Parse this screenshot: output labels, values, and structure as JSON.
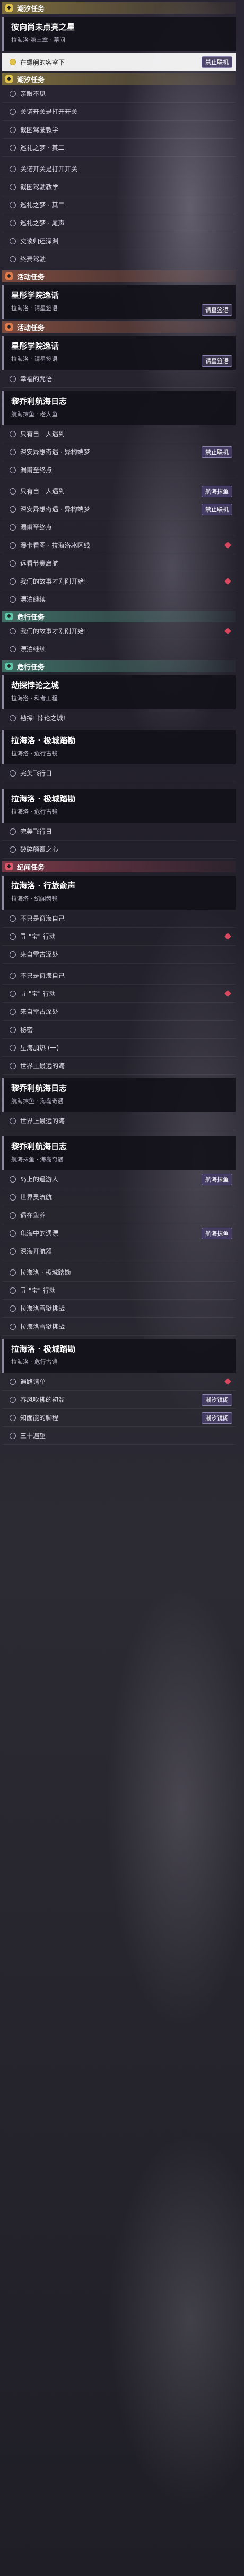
{
  "sections": [
    {
      "type": "header",
      "color": "yellow",
      "label": "潮汐任务"
    },
    {
      "type": "quest",
      "title": "彼向尚未点亮之星",
      "sub": "拉海洛·第三章 · 幕间"
    },
    {
      "type": "step",
      "label": "在螺舸的客室下",
      "current": true,
      "badge": "禁止联机"
    },
    {
      "type": "header",
      "color": "yellow",
      "label": "潮汐任务"
    },
    {
      "type": "step",
      "label": "亲眼不见"
    },
    {
      "type": "step",
      "label": "关诺开关是打开开关"
    },
    {
      "type": "step",
      "label": "截困驾驶教学"
    },
    {
      "type": "step",
      "label": "巡礼之梦 · 其二"
    },
    {
      "type": "spacer"
    },
    {
      "type": "step",
      "label": "关诺开关是打开开关"
    },
    {
      "type": "step",
      "label": "截困驾驶教学"
    },
    {
      "type": "step",
      "label": "巡礼之梦 · 其二"
    },
    {
      "type": "step",
      "label": "巡礼之梦 · 尾声"
    },
    {
      "type": "step",
      "label": "交谈归还深渊"
    },
    {
      "type": "step",
      "label": "终焉驾驶"
    },
    {
      "type": "header",
      "color": "orange",
      "label": "活动任务"
    },
    {
      "type": "quest",
      "title": "星彤学院逸话",
      "sub": "拉海洛 · 请星签语",
      "badge": "请星签语"
    },
    {
      "type": "header",
      "color": "orange",
      "label": "活动任务"
    },
    {
      "type": "quest",
      "title": "星彤学院逸话",
      "sub": "拉海洛 · 请星签语",
      "badge": "请星签语"
    },
    {
      "type": "step",
      "label": "幸福的咒语"
    },
    {
      "type": "quest",
      "title": "黎乔利航海日志",
      "sub": "航海抹鱼 · 老人鱼"
    },
    {
      "type": "step",
      "label": "只有自一人遇到"
    },
    {
      "type": "step",
      "label": "深安异想奇遇 · 异构端梦",
      "badge": "禁止联机"
    },
    {
      "type": "step",
      "label": "漏甫至终点"
    },
    {
      "type": "spacer"
    },
    {
      "type": "step",
      "label": "只有自一人遇到",
      "badge": "航海抹鱼"
    },
    {
      "type": "step",
      "label": "深安异想奇遇 · 异构端梦",
      "badge": "禁止联机"
    },
    {
      "type": "step",
      "label": "漏甫至终点"
    },
    {
      "type": "step",
      "label": "瀑卡看图 · 拉海洛冰区线",
      "diamond": true
    },
    {
      "type": "step",
      "label": "远看节奏启航"
    },
    {
      "type": "step",
      "label": "我们的故事才刚刚开始!",
      "diamond": true
    },
    {
      "type": "step",
      "label": "漂泊继续"
    },
    {
      "type": "header",
      "color": "teal",
      "label": "危行任务"
    },
    {
      "type": "step",
      "label": "我们的故事才刚刚开始!",
      "diamond": true
    },
    {
      "type": "step",
      "label": "漂泊继续"
    },
    {
      "type": "header",
      "color": "teal",
      "label": "危行任务"
    },
    {
      "type": "quest",
      "title": "劫探悖论之城",
      "sub": "拉海洛 · 科考工程"
    },
    {
      "type": "step",
      "label": "勘探! 悖论之城!"
    },
    {
      "type": "quest",
      "title": "拉海洛 · 极城踏勘",
      "sub": "拉海洛 · 危行古镜"
    },
    {
      "type": "step",
      "label": "完美飞行日"
    },
    {
      "type": "spacer"
    },
    {
      "type": "quest",
      "title": "拉海洛 · 极城踏勘",
      "sub": "拉海洛 · 危行古镜"
    },
    {
      "type": "step",
      "label": "完美飞行日"
    },
    {
      "type": "step",
      "label": "破碎颠覆之心"
    },
    {
      "type": "header",
      "color": "red",
      "label": "纪闻任务"
    },
    {
      "type": "quest",
      "title": "拉海洛 · 行旅俞声",
      "sub": "拉海洛 · 纪闻齿镜"
    },
    {
      "type": "step",
      "label": "不只是窗海自己"
    },
    {
      "type": "step",
      "label": "寻 \"宝\" 行动",
      "diamond": true
    },
    {
      "type": "step",
      "label": "来自雷古深处"
    },
    {
      "type": "spacer"
    },
    {
      "type": "step",
      "label": "不只是窗海自己"
    },
    {
      "type": "step",
      "label": "寻 \"宝\" 行动",
      "diamond": true
    },
    {
      "type": "step",
      "label": "来自雷古深处"
    },
    {
      "type": "step",
      "label": "秘密"
    },
    {
      "type": "step",
      "label": "星海加热 (一)"
    },
    {
      "type": "step",
      "label": "世界上最远的海"
    },
    {
      "type": "quest",
      "title": "黎乔利航海日志",
      "sub": "航海抹鱼 · 海岛奇遇"
    },
    {
      "type": "step",
      "label": "世界上最远的海"
    },
    {
      "type": "spacer"
    },
    {
      "type": "quest",
      "title": "黎乔利航海日志",
      "sub": "航海抹鱼 · 海岛奇遇"
    },
    {
      "type": "step",
      "label": "岛上的遥游人",
      "badge": "航海抹鱼"
    },
    {
      "type": "step",
      "label": "世界灵流航"
    },
    {
      "type": "step",
      "label": "遇在鱼养"
    },
    {
      "type": "step",
      "label": "龟海中的遇漂",
      "badge": "航海抹鱼"
    },
    {
      "type": "step",
      "label": "深海开航器"
    },
    {
      "type": "spacer"
    },
    {
      "type": "step",
      "label": "拉海洛 · 极城踏勘"
    },
    {
      "type": "step",
      "label": "寻 \"宝\" 行动"
    },
    {
      "type": "step",
      "label": "拉海洛雪狱挑战"
    },
    {
      "type": "step",
      "label": "拉海洛雪狱挑战"
    },
    {
      "type": "quest",
      "title": "拉海洛 · 极城踏勘",
      "sub": "拉海洛 · 危行古镜"
    },
    {
      "type": "step",
      "label": "遇路请单",
      "diamond": true
    },
    {
      "type": "step",
      "label": "春风吹拂的初溜",
      "badge": "潮汐镜阁"
    },
    {
      "type": "step",
      "label": "知面能的脚程",
      "badge": "潮汐镜阁"
    },
    {
      "type": "step",
      "label": "三十遍望"
    }
  ]
}
